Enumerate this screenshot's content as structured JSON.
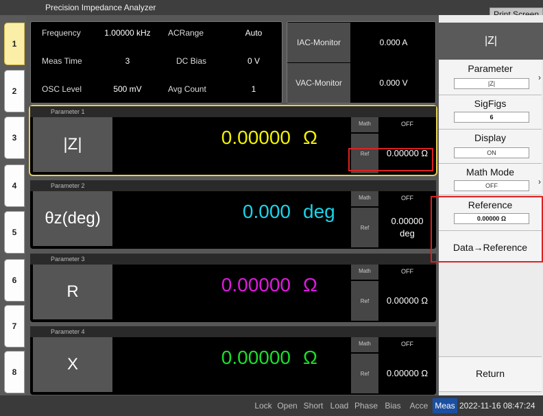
{
  "window": {
    "title": "Precision Impedance Analyzer",
    "print_button": "Print Screen"
  },
  "tabs": [
    "1",
    "2",
    "3",
    "4",
    "5",
    "6",
    "7",
    "8"
  ],
  "settings": {
    "frequency_label": "Frequency",
    "frequency_value": "1.00000 kHz",
    "acrange_label": "ACRange",
    "acrange_value": "Auto",
    "meas_time_label": "Meas Time",
    "meas_time_value": "3",
    "dc_bias_label": "DC Bias",
    "dc_bias_value": "0 V",
    "osc_level_label": "OSC Level",
    "osc_level_value": "500 mV",
    "avg_count_label": "Avg Count",
    "avg_count_value": "1"
  },
  "monitors": {
    "iac_label": "IAC-Monitor",
    "iac_value": "0.000 A",
    "vac_label": "VAC-Monitor",
    "vac_value": "0.000 V"
  },
  "parameters": [
    {
      "header": "Parameter 1",
      "name": "|Z|",
      "value": "0.00000",
      "unit": "Ω",
      "color": "#f2f200",
      "math_label": "Math",
      "math_value": "OFF",
      "ref_label": "Ref",
      "ref_value": "0.00000 Ω"
    },
    {
      "header": "Parameter 2",
      "name": "θz(deg)",
      "value": "0.000",
      "unit": "deg",
      "color": "#19d4e8",
      "math_label": "Math",
      "math_value": "OFF",
      "ref_label": "Ref",
      "ref_value": "0.00000 deg"
    },
    {
      "header": "Parameter 3",
      "name": "R",
      "value": "0.00000",
      "unit": "Ω",
      "color": "#e018e0",
      "math_label": "Math",
      "math_value": "OFF",
      "ref_label": "Ref",
      "ref_value": "0.00000 Ω"
    },
    {
      "header": "Parameter 4",
      "name": "X",
      "value": "0.00000",
      "unit": "Ω",
      "color": "#18e028",
      "math_label": "Math",
      "math_value": "OFF",
      "ref_label": "Ref",
      "ref_value": "0.00000 Ω"
    }
  ],
  "softkeys": {
    "header": "|Z|",
    "parameter_label": "Parameter",
    "parameter_value": "|Z|",
    "sigfigs_label": "SigFigs",
    "sigfigs_value": "6",
    "display_label": "Display",
    "display_value": "ON",
    "math_mode_label": "Math Mode",
    "math_mode_value": "OFF",
    "reference_label": "Reference",
    "reference_value": "0.00000 Ω",
    "data_reference_label": "Data→Reference",
    "return_label": "Return"
  },
  "status_bar": {
    "items": [
      "Lock",
      "Open",
      "Short",
      "Load",
      "Phase",
      "Bias",
      "Acce",
      "Meas"
    ],
    "active": "Meas",
    "datetime": "2022-11-16 08:47:24"
  }
}
